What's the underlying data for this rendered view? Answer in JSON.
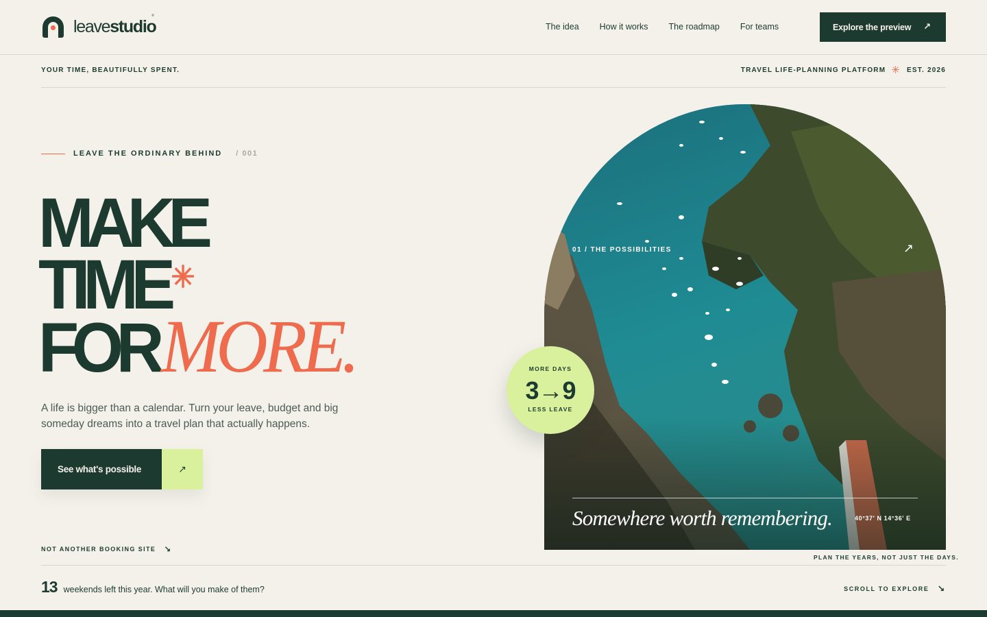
{
  "brand": {
    "name_light": "leave",
    "name_bold": "studio",
    "reg_mark": "°"
  },
  "nav": {
    "items": [
      {
        "label": "The idea"
      },
      {
        "label": "How it works"
      },
      {
        "label": "The roadmap"
      },
      {
        "label": "For teams"
      }
    ],
    "cta_label": "Explore the preview",
    "cta_icon": "arrow-up-right-icon"
  },
  "subbar": {
    "tagline": "YOUR TIME, BEAUTIFULLY SPENT.",
    "platform": "TRAVEL LIFE-PLANNING PLATFORM",
    "star": "✳",
    "established": "EST. 2026"
  },
  "hero": {
    "eyebrow": "LEAVE THE ORDINARY BEHIND",
    "eyebrow_number": "/ 001",
    "headline_line1": "MAKE",
    "headline_line2": "TIME",
    "headline_star": "✳",
    "headline_line3_a": "FOR",
    "headline_line3_b": "MORE.",
    "lede": "A life is bigger than a calendar. Turn your leave, budget and big someday dreams into a travel plan that actually happens.",
    "cta_label": "See what's possible",
    "cta_arrow": "↗",
    "not_booking": "NOT ANOTHER BOOKING SITE",
    "not_booking_arrow": "↘"
  },
  "image_card": {
    "label": "01 / THE POSSIBILITIES",
    "arrow": "↗",
    "quote": "Somewhere worth remembering.",
    "coords": "40°37′ N   14°36′ E",
    "caption": "PLAN THE YEARS, NOT JUST THE DAYS."
  },
  "badge": {
    "top": "MORE DAYS",
    "value": "3→9",
    "bottom": "LESS LEAVE"
  },
  "footer": {
    "count": "13",
    "text": "weekends left this year. What will you make of them?",
    "scroll": "SCROLL TO EXPLORE",
    "scroll_arrow": "↘"
  },
  "colors": {
    "background": "#f4f1ea",
    "primary": "#1c3a30",
    "accent": "#ee6c4d",
    "lime": "#d9f19d"
  }
}
